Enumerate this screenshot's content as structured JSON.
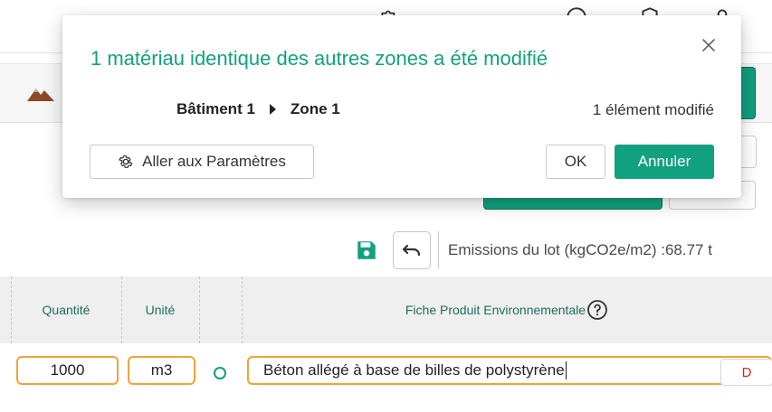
{
  "colors": {
    "accent": "#12a17f",
    "orange_border": "#f0a33a",
    "header_text": "#1d6e5c",
    "danger": "#c62828"
  },
  "background": {
    "emissions_label": "Emissions du lot (kgCO2e/m2) :68.77 t",
    "table": {
      "headers": [
        "Quantité",
        "Unité",
        "Fiche Produit Environnementale"
      ],
      "row": {
        "quantity": "1000",
        "unit": "m3",
        "product": "Béton allégé à base de billes de polystyrène",
        "action": "D"
      }
    }
  },
  "modal": {
    "title": "1 matériau identique des autres zones a été modifié",
    "breadcrumb": [
      "Bâtiment 1",
      "Zone 1"
    ],
    "changed_count": "1 élément modifié",
    "settings_button": "Aller aux Paramètres",
    "ok_button": "OK",
    "cancel_button": "Annuler"
  }
}
